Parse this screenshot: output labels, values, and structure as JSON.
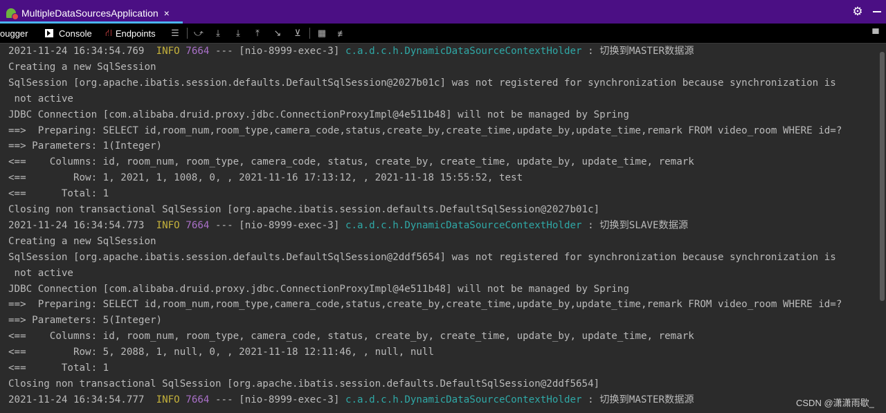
{
  "titlebar": {
    "run_tab_label": "MultipleDataSourcesApplication",
    "close_glyph": "×",
    "settings_icon": "gear-icon",
    "minimize_icon": "minimize-icon"
  },
  "toolbar": {
    "debugger_label": "ougger",
    "console_label": "Console",
    "endpoints_label": "Endpoints"
  },
  "console": {
    "lines": [
      {
        "time": "2021-11-24 16:34:54.769",
        "level": "INFO",
        "pid": "7664",
        "sep": "---",
        "thread": "[nio-8999-exec-3]",
        "logger": "c.a.d.c.h.DynamicDataSourceContextHolder",
        "message": ": 切换到MASTER数据源"
      },
      "Creating a new SqlSession",
      "SqlSession [org.apache.ibatis.session.defaults.DefaultSqlSession@2027b01c] was not registered for synchronization because synchronization is",
      " not active",
      "JDBC Connection [com.alibaba.druid.proxy.jdbc.ConnectionProxyImpl@4e511b48] will not be managed by Spring",
      "==>  Preparing: SELECT id,room_num,room_type,camera_code,status,create_by,create_time,update_by,update_time,remark FROM video_room WHERE id=?",
      "==> Parameters: 1(Integer)",
      "<==    Columns: id, room_num, room_type, camera_code, status, create_by, create_time, update_by, update_time, remark",
      "<==        Row: 1, 2021, 1, 1008, 0, , 2021-11-16 17:13:12, , 2021-11-18 15:55:52, test",
      "<==      Total: 1",
      "Closing non transactional SqlSession [org.apache.ibatis.session.defaults.DefaultSqlSession@2027b01c]",
      {
        "time": "2021-11-24 16:34:54.773",
        "level": "INFO",
        "pid": "7664",
        "sep": "---",
        "thread": "[nio-8999-exec-3]",
        "logger": "c.a.d.c.h.DynamicDataSourceContextHolder",
        "message": ": 切换到SLAVE数据源"
      },
      "Creating a new SqlSession",
      "SqlSession [org.apache.ibatis.session.defaults.DefaultSqlSession@2ddf5654] was not registered for synchronization because synchronization is",
      " not active",
      "JDBC Connection [com.alibaba.druid.proxy.jdbc.ConnectionProxyImpl@4e511b48] will not be managed by Spring",
      "==>  Preparing: SELECT id,room_num,room_type,camera_code,status,create_by,create_time,update_by,update_time,remark FROM video_room WHERE id=?",
      "==> Parameters: 5(Integer)",
      "<==    Columns: id, room_num, room_type, camera_code, status, create_by, create_time, update_by, update_time, remark",
      "<==        Row: 5, 2088, 1, null, 0, , 2021-11-18 12:11:46, , null, null",
      "<==      Total: 1",
      "Closing non transactional SqlSession [org.apache.ibatis.session.defaults.DefaultSqlSession@2ddf5654]",
      {
        "time": "2021-11-24 16:34:54.777",
        "level": "INFO",
        "pid": "7664",
        "sep": "---",
        "thread": "[nio-8999-exec-3]",
        "logger": "c.a.d.c.h.DynamicDataSourceContextHolder",
        "message": ": 切换到MASTER数据源"
      }
    ]
  },
  "watermark": "CSDN @潇潇雨歇_",
  "colors": {
    "titlebar_bg": "#4b0f84",
    "tab_underline": "#4bb5f0",
    "console_bg": "#2b2b2b",
    "text": "#bbbbbb",
    "info": "#c5b23b",
    "pid": "#a970c8",
    "logger": "#2fa8a6"
  }
}
